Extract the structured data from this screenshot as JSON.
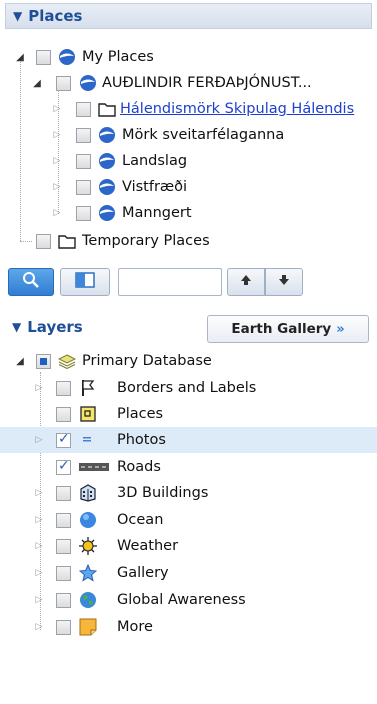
{
  "places": {
    "header": "Places",
    "items": [
      {
        "label": "My Places"
      },
      {
        "label": "AUÐLINDIR FERÐAÞJÓNUST..."
      },
      {
        "label": "Hálendismörk Skipulag Hálendis"
      },
      {
        "label": "Mörk sveitarfélaganna"
      },
      {
        "label": "Landslag"
      },
      {
        "label": "Vistfræði"
      },
      {
        "label": "Manngert"
      },
      {
        "label": "Temporary Places"
      }
    ]
  },
  "toolbar": {
    "search_value": ""
  },
  "layers": {
    "header": "Layers",
    "earth_gallery_label": "Earth Gallery",
    "earth_gallery_chevron": "»",
    "items": [
      {
        "label": "Primary Database"
      },
      {
        "label": "Borders and Labels"
      },
      {
        "label": "Places"
      },
      {
        "label": "Photos"
      },
      {
        "label": "Roads"
      },
      {
        "label": "3D Buildings"
      },
      {
        "label": "Ocean"
      },
      {
        "label": "Weather"
      },
      {
        "label": "Gallery"
      },
      {
        "label": "Global Awareness"
      },
      {
        "label": "More"
      }
    ]
  },
  "colors": {
    "header_text": "#1f4f96",
    "link": "#1d3fcf",
    "selected_row": "#ddeaf8",
    "active_button": "#2f7ed2"
  }
}
